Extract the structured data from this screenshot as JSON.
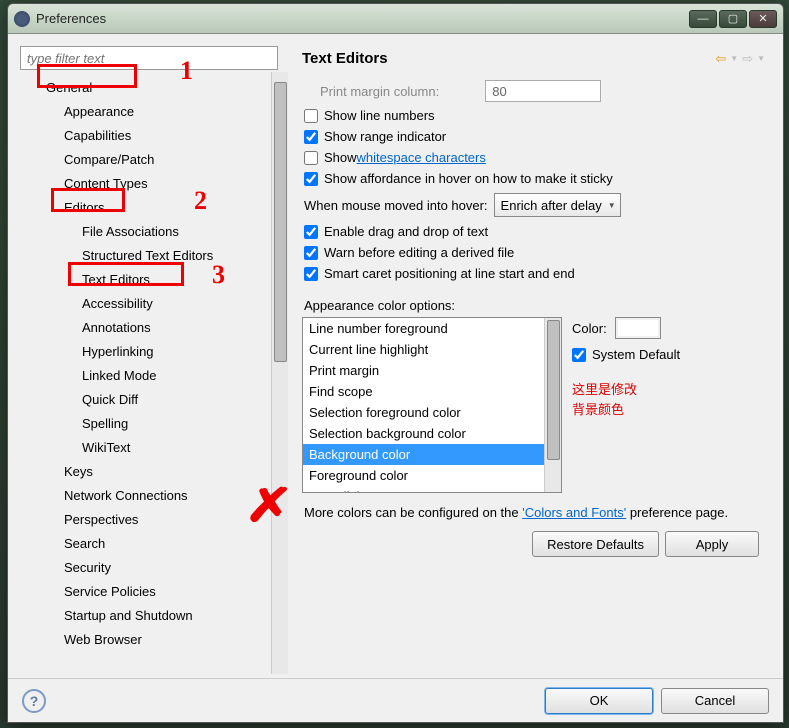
{
  "window": {
    "title": "Preferences"
  },
  "filter": {
    "placeholder": "type filter text"
  },
  "tree": {
    "items": [
      {
        "label": "General",
        "lvl": 1
      },
      {
        "label": "Appearance",
        "lvl": 2
      },
      {
        "label": "Capabilities",
        "lvl": 2
      },
      {
        "label": "Compare/Patch",
        "lvl": 2
      },
      {
        "label": "Content Types",
        "lvl": 2
      },
      {
        "label": "Editors",
        "lvl": 2
      },
      {
        "label": "File Associations",
        "lvl": 3
      },
      {
        "label": "Structured Text Editors",
        "lvl": 3
      },
      {
        "label": "Text Editors",
        "lvl": 3
      },
      {
        "label": "Accessibility",
        "lvl": 3
      },
      {
        "label": "Annotations",
        "lvl": 3
      },
      {
        "label": "Hyperlinking",
        "lvl": 3
      },
      {
        "label": "Linked Mode",
        "lvl": 3
      },
      {
        "label": "Quick Diff",
        "lvl": 3
      },
      {
        "label": "Spelling",
        "lvl": 3
      },
      {
        "label": "WikiText",
        "lvl": 3
      },
      {
        "label": "Keys",
        "lvl": 2
      },
      {
        "label": "Network Connections",
        "lvl": 2
      },
      {
        "label": "Perspectives",
        "lvl": 2
      },
      {
        "label": "Search",
        "lvl": 2
      },
      {
        "label": "Security",
        "lvl": 2
      },
      {
        "label": "Service Policies",
        "lvl": 2
      },
      {
        "label": "Startup and Shutdown",
        "lvl": 2
      },
      {
        "label": "Web Browser",
        "lvl": 2
      }
    ]
  },
  "right": {
    "title": "Text Editors",
    "print_margin_label": "Print margin column:",
    "print_margin_value": "80",
    "show_line_numbers": "Show line numbers",
    "show_range": "Show range indicator",
    "show_ws_prefix": "Show ",
    "show_ws_link": "whitespace characters",
    "show_affordance": "Show affordance in hover on how to make it sticky",
    "hover_label": "When mouse moved into hover:",
    "hover_value": "Enrich after delay",
    "enable_dnd": "Enable drag and drop of text",
    "warn_derived": "Warn before editing a derived file",
    "smart_caret": "Smart caret positioning at line start and end",
    "appearance_label": "Appearance color options:",
    "color_label": "Color:",
    "system_default": "System Default",
    "red_note_1": "这里是修改",
    "red_note_2": "背景颜色",
    "more_prefix": "More colors can be configured on the ",
    "more_link": "'Colors and Fonts'",
    "more_suffix": " preference page."
  },
  "list_items": [
    "Line number foreground",
    "Current line highlight",
    "Print margin",
    "Find scope",
    "Selection foreground color",
    "Selection background color",
    "Background color",
    "Foreground color",
    "Hyperlink"
  ],
  "buttons": {
    "restore": "Restore Defaults",
    "apply": "Apply",
    "ok": "OK",
    "cancel": "Cancel"
  },
  "annotations": {
    "n1": "1",
    "n2": "2",
    "n3": "3",
    "x": "✗"
  }
}
